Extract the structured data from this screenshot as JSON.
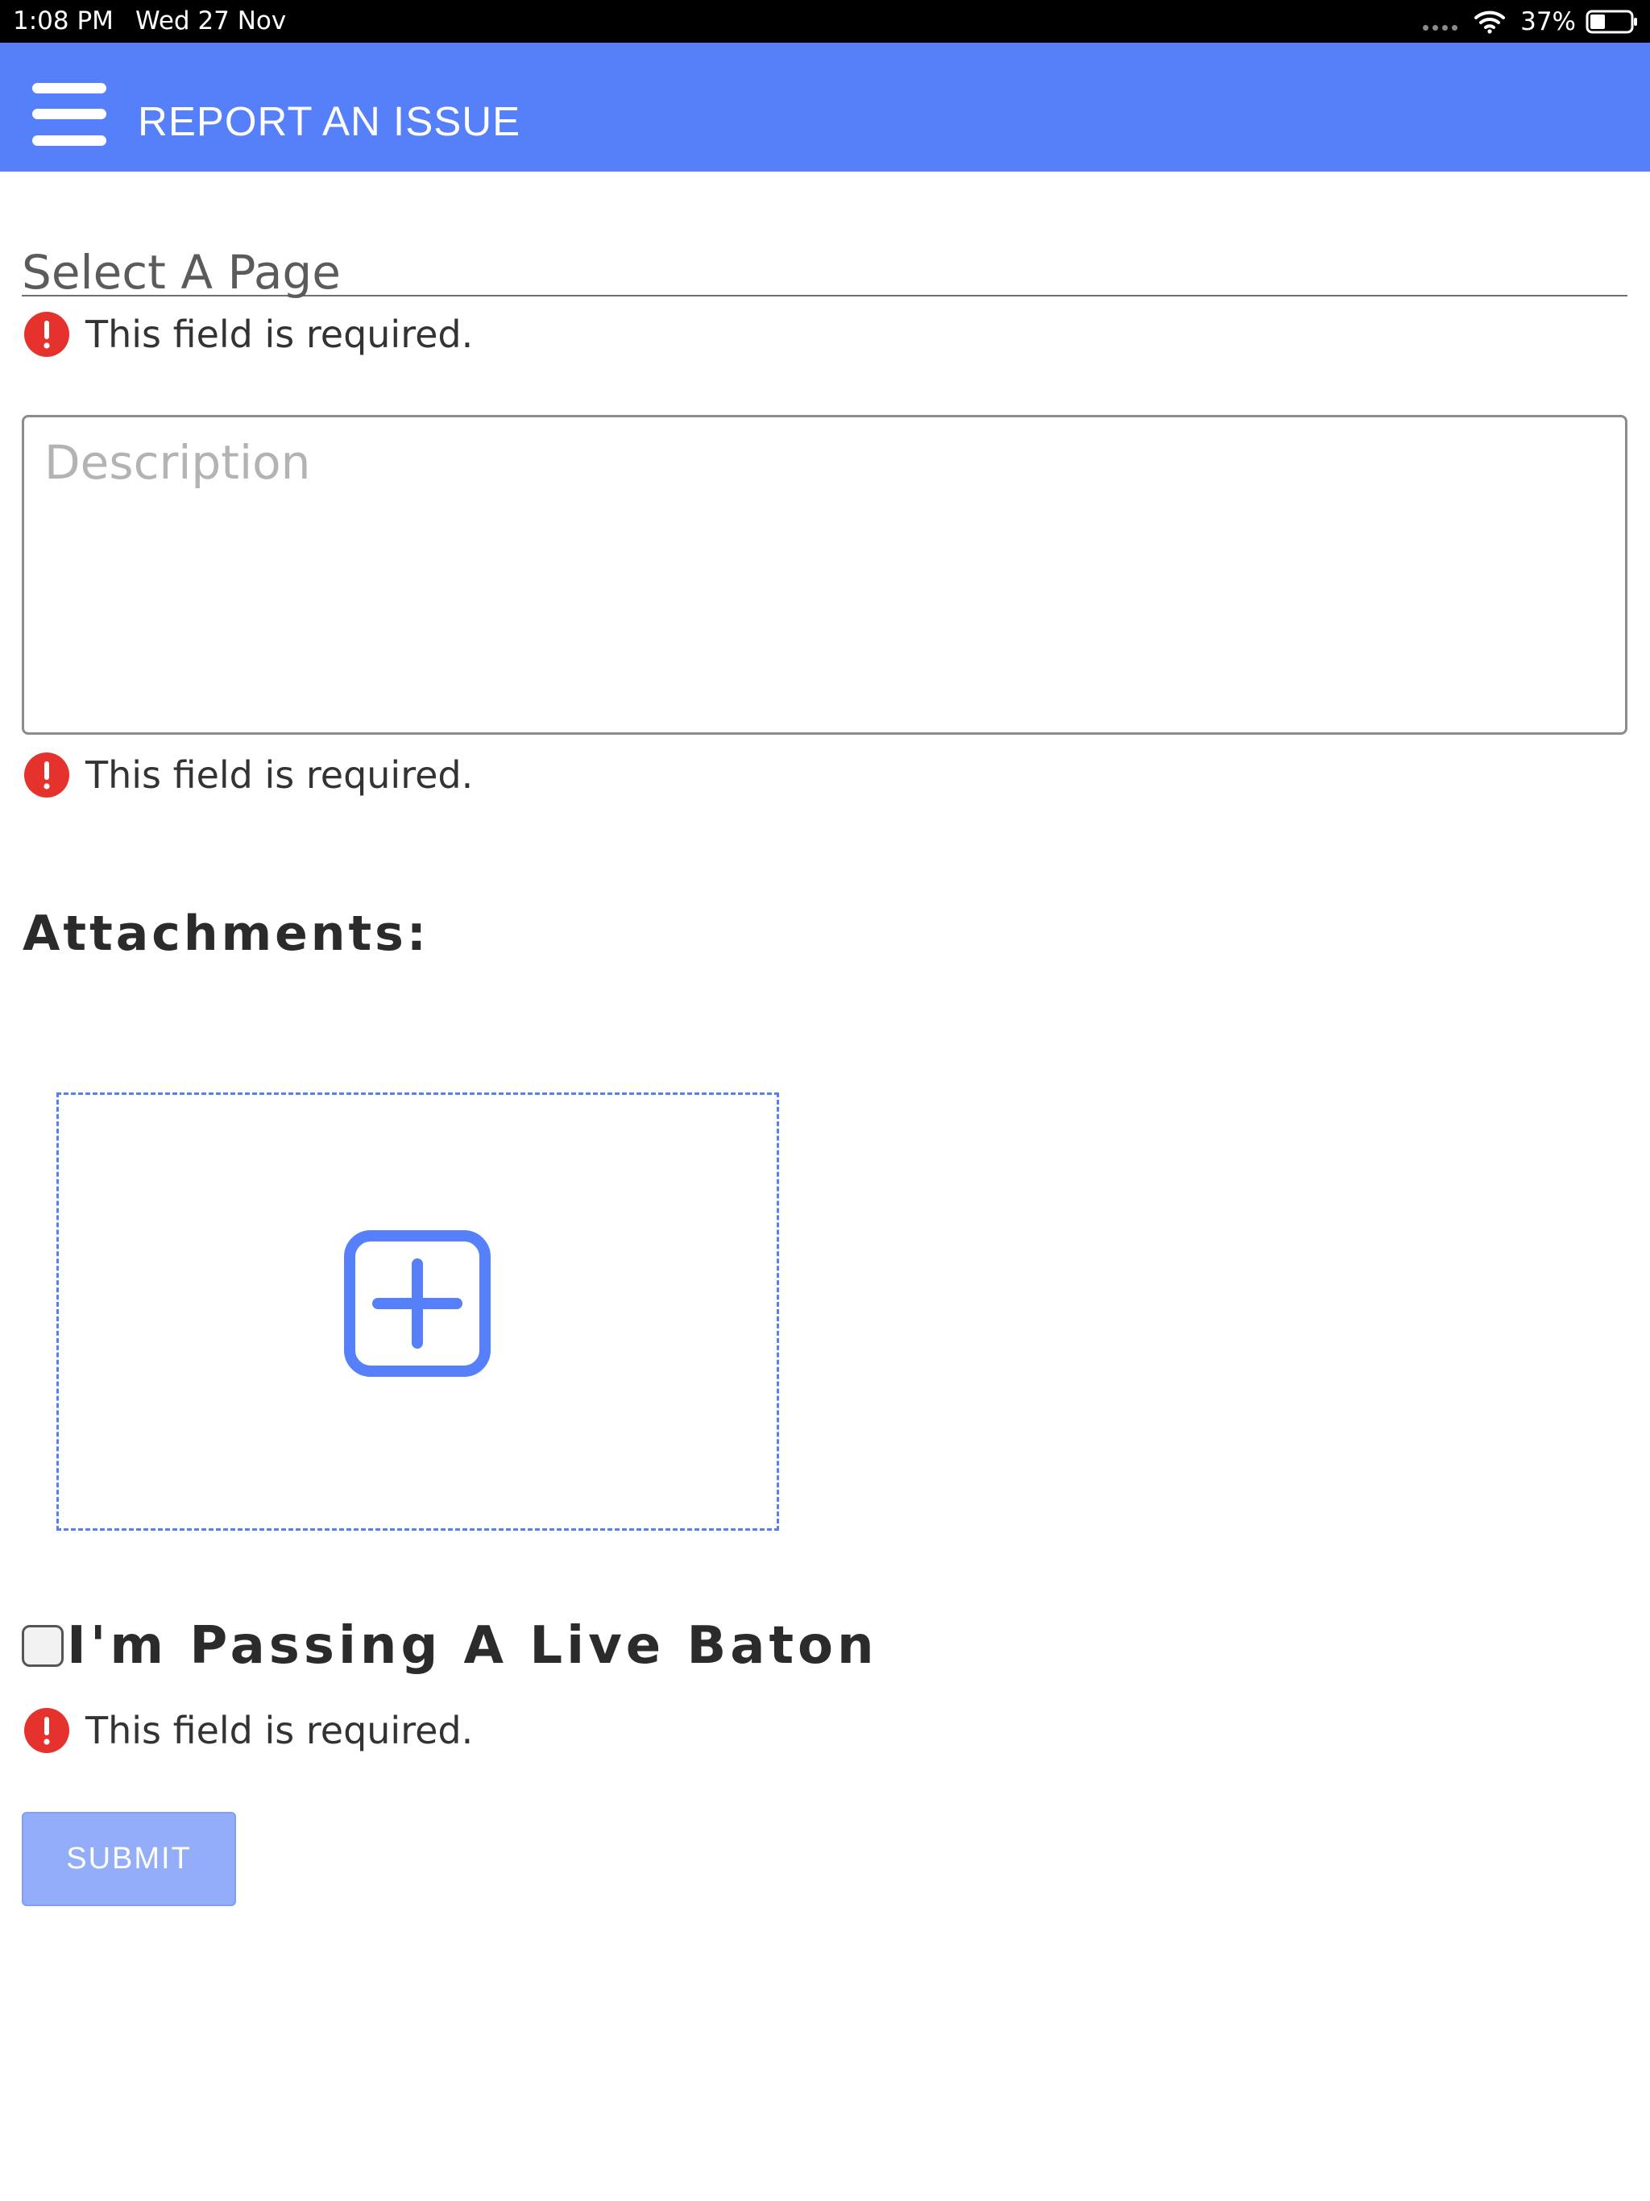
{
  "status_bar": {
    "time": "1:08 PM",
    "date": "Wed 27 Nov",
    "battery": "37%"
  },
  "app_bar": {
    "title": "REPORT AN ISSUE",
    "menu_icon": "hamburger-menu-icon"
  },
  "form": {
    "select_page": {
      "label": "Select A Page",
      "error": "This field is required."
    },
    "description": {
      "placeholder": "Description",
      "value": "",
      "error": "This field is required."
    },
    "attachments": {
      "heading": "Attachments:",
      "add_icon": "plus-square-icon"
    },
    "live_baton": {
      "label": "I'm Passing A Live Baton",
      "checked": false,
      "error": "This field is required."
    },
    "submit_label": "SUBMIT"
  },
  "colors": {
    "accent": "#5680fa",
    "error": "#e5322d",
    "submit_disabled": "#93adf9"
  }
}
